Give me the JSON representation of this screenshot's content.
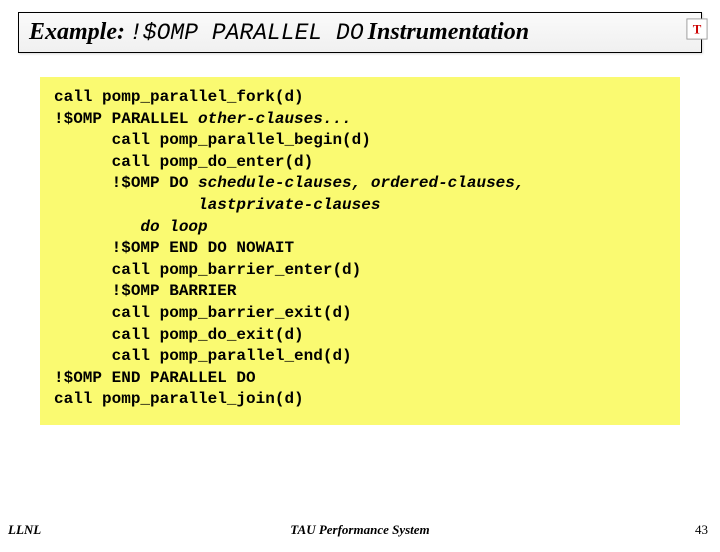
{
  "title": {
    "prefix": "Example:",
    "mono": "!$OMP PARALLEL DO",
    "suffix": "Instrumentation"
  },
  "code": {
    "l1": "call pomp_parallel_fork(d)",
    "l2a": "!$OMP PARALLEL ",
    "l2b": "other-clauses...",
    "l3": "      call pomp_parallel_begin(d)",
    "l4": "      call pomp_do_enter(d)",
    "l5a": "      !$OMP DO ",
    "l5b": "schedule-clauses, ordered-clauses,",
    "l6": "               lastprivate-clauses",
    "l7": "         do loop",
    "l8": "      !$OMP END DO NOWAIT",
    "l9": "      call pomp_barrier_enter(d)",
    "l10": "      !$OMP BARRIER",
    "l11": "      call pomp_barrier_exit(d)",
    "l12": "      call pomp_do_exit(d)",
    "l13": "      call pomp_parallel_end(d)",
    "l14": "!$OMP END PARALLEL DO",
    "l15": "call pomp_parallel_join(d)"
  },
  "footer": {
    "left": "LLNL",
    "center": "TAU Performance System",
    "right": "43"
  },
  "logo": {
    "name": "tau-logo"
  }
}
